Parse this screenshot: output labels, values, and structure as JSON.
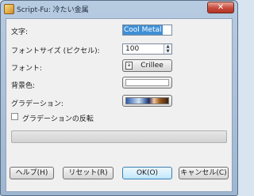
{
  "window": {
    "title": "Script-Fu: 冷たい金属",
    "close_glyph": "✕"
  },
  "form": {
    "text_label": "文字:",
    "text_value": "Cool Metal",
    "font_size_label": "フォントサイズ (ピクセル):",
    "font_size_value": "100",
    "font_label": "フォント:",
    "font_value": "Crillee",
    "font_icon_glyph": "a",
    "bg_color_label": "背景色:",
    "bg_color": "#ffffff",
    "gradient_label": "グラデーション:",
    "reverse_gradient_label": "グラデーションの反転",
    "reverse_gradient_checked": false,
    "progress": 0
  },
  "buttons": {
    "help": "ヘルプ(H)",
    "reset": "リセット(R)",
    "ok": "OK(O)",
    "cancel": "キャンセル(C)"
  },
  "colors": {
    "accent_selection": "#3f8fd6",
    "progress_fill": "#4fa93a"
  },
  "icons": [
    "app-icon",
    "close-icon",
    "font-icon",
    "spin-up-icon",
    "spin-down-icon"
  ]
}
